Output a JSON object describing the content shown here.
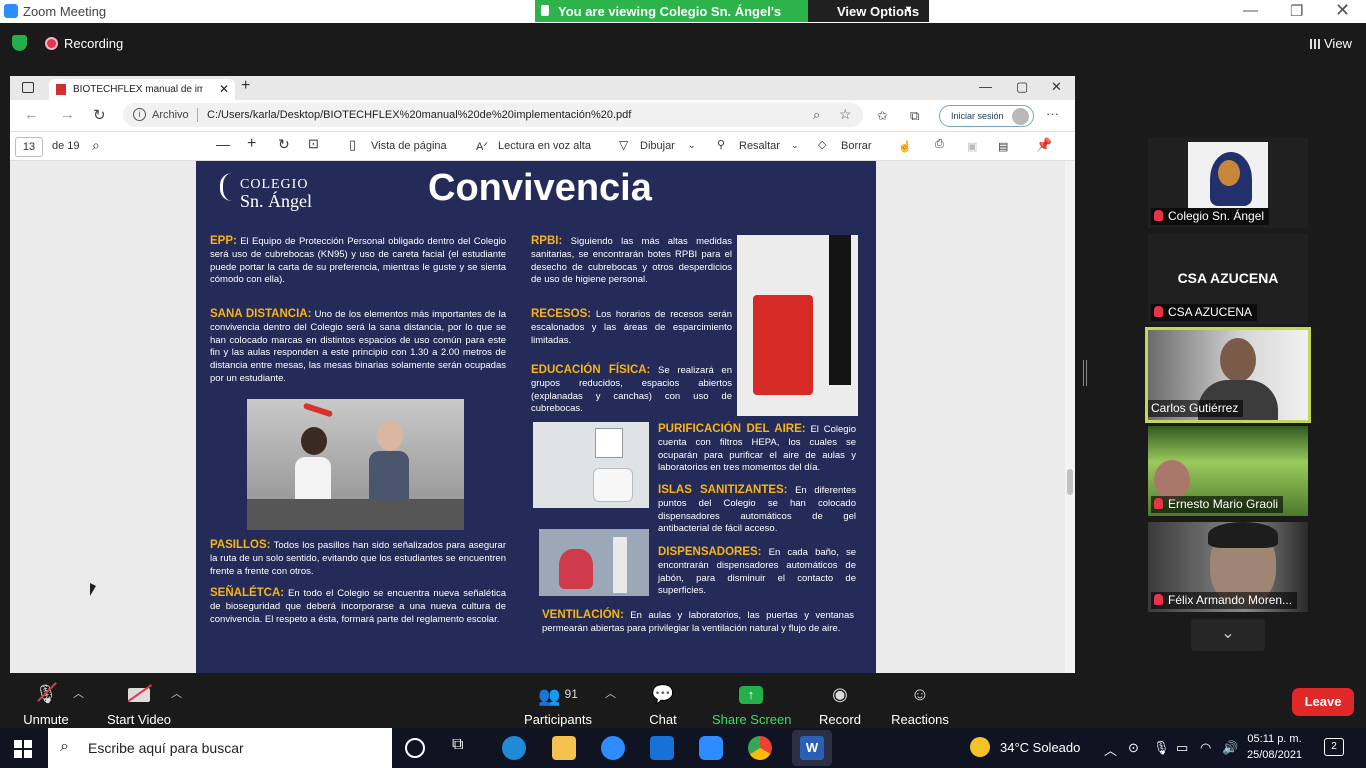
{
  "window": {
    "title": "Zoom Meeting",
    "banner": "You are viewing Colegio Sn. Ángel's screen",
    "view_options": "View Options"
  },
  "top": {
    "recording": "Recording",
    "view": "View"
  },
  "edge": {
    "tab_title": "BIOTECHFLEX manual de implem",
    "url_label": "Archivo",
    "url": "C:/Users/karla/Desktop/BIOTECHFLEX%20manual%20de%20implementación%20.pdf",
    "sign_in": "Iniciar sesión",
    "page_current": "13",
    "page_total": "de 19",
    "toolbar": {
      "page_view": "Vista de página",
      "read_aloud": "Lectura en voz alta",
      "draw": "Dibujar",
      "highlight": "Resaltar",
      "erase": "Borrar"
    }
  },
  "pdf": {
    "logo_line1": "COLEGIO",
    "logo_line2": "Sn. Ángel",
    "title": "Convivencia",
    "epp": {
      "h": "EPP:",
      "t": " El Equipo de Protección Personal obligado dentro del Colegio será uso de cubrebocas (KN95) y uso de careta facial (el estudiante puede portar la carta de su preferencia, mientras le guste y se sienta cómodo con ella)."
    },
    "sana": {
      "h": "SANA DISTANCIA:",
      "t": " Uno de los elementos más importantes de la convivencia dentro del Colegio será la sana distancia, por lo que se han colocado marcas en distintos espacios de uso común para este fin y las aulas responden a este principio con 1.30 a 2.00 metros de distancia entre mesas, las mesas binarias solamente serán ocupadas por un estudiante."
    },
    "pasillos": {
      "h": "PASILLOS:",
      "t": " Todos los pasillos han sido señalizados para asegurar la ruta de un solo sentido, evitando que los estudiantes se encuentren frente a frente con otros."
    },
    "senaletica": {
      "h": "SEÑALÉTCA:",
      "t": " En todo el Colegio se encuentra nueva señalética de bioseguridad que deberá incorporarse a una nueva cultura de convivencia. El respeto a ésta, formará parte del reglamento escolar."
    },
    "rpbi": {
      "h": "RPBI:",
      "t": " Siguiendo las más altas medidas sanitarias, se encontrarán botes RPBI para el desecho de cubrebocas y otros desperdicios de uso de higiene personal."
    },
    "recesos": {
      "h": "RECESOS:",
      "t": " Los horarios de recesos serán escalonados y las áreas de esparcimiento limitadas."
    },
    "edfisica": {
      "h": "EDUCACIÓN FÍSICA:",
      "t": " Se realizará en grupos reducidos, espacios abiertos (explanadas y canchas) con uso de cubrebocas."
    },
    "purificacion": {
      "h": "PURIFICACIÓN DEL AIRE:",
      "t": " El Colegio cuenta con filtros HEPA, los cuales se ocuparán para purificar el aire de aulas y laboratorios en tres momentos del día."
    },
    "islas": {
      "h": "ISLAS SANITIZANTES:",
      "t": " En diferentes puntos del Colegio se han colocado dispensadores automáticos de gel antibacterial de fácil acceso."
    },
    "dispensadores": {
      "h": "DISPENSADORES:",
      "t": " En cada baño, se encontrarán dispensadores automáticos de jabón, para disminuir el contacto de superficies."
    },
    "ventilacion": {
      "h": "VENTILACIÓN:",
      "t": " En aulas y laboratorios, las puertas y ventanas permearán abiertas para privilegiar la ventilación natural y flujo de aire."
    }
  },
  "participants": [
    {
      "name": "Colegio Sn. Ángel"
    },
    {
      "name": "CSA AZUCENA",
      "display": "CSA AZUCENA"
    },
    {
      "name": "Carlos Gutiérrez"
    },
    {
      "name": "Ernesto Mario Graoli"
    },
    {
      "name": "Félix Armando Moren..."
    }
  ],
  "controls": {
    "unmute": "Unmute",
    "start_video": "Start Video",
    "participants": "Participants",
    "participants_count": "91",
    "chat": "Chat",
    "share": "Share Screen",
    "record": "Record",
    "reactions": "Reactions",
    "leave": "Leave"
  },
  "taskbar": {
    "search": "Escribe aquí para buscar",
    "weather": "34°C  Soleado",
    "time": "05:11 p. m.",
    "date": "25/08/2021",
    "notifications": "2"
  },
  "colors": {
    "zoom_green": "#2cb34a",
    "leave_red": "#e02828",
    "pdf_navy": "#252b58",
    "pdf_heading": "#f7b417"
  }
}
